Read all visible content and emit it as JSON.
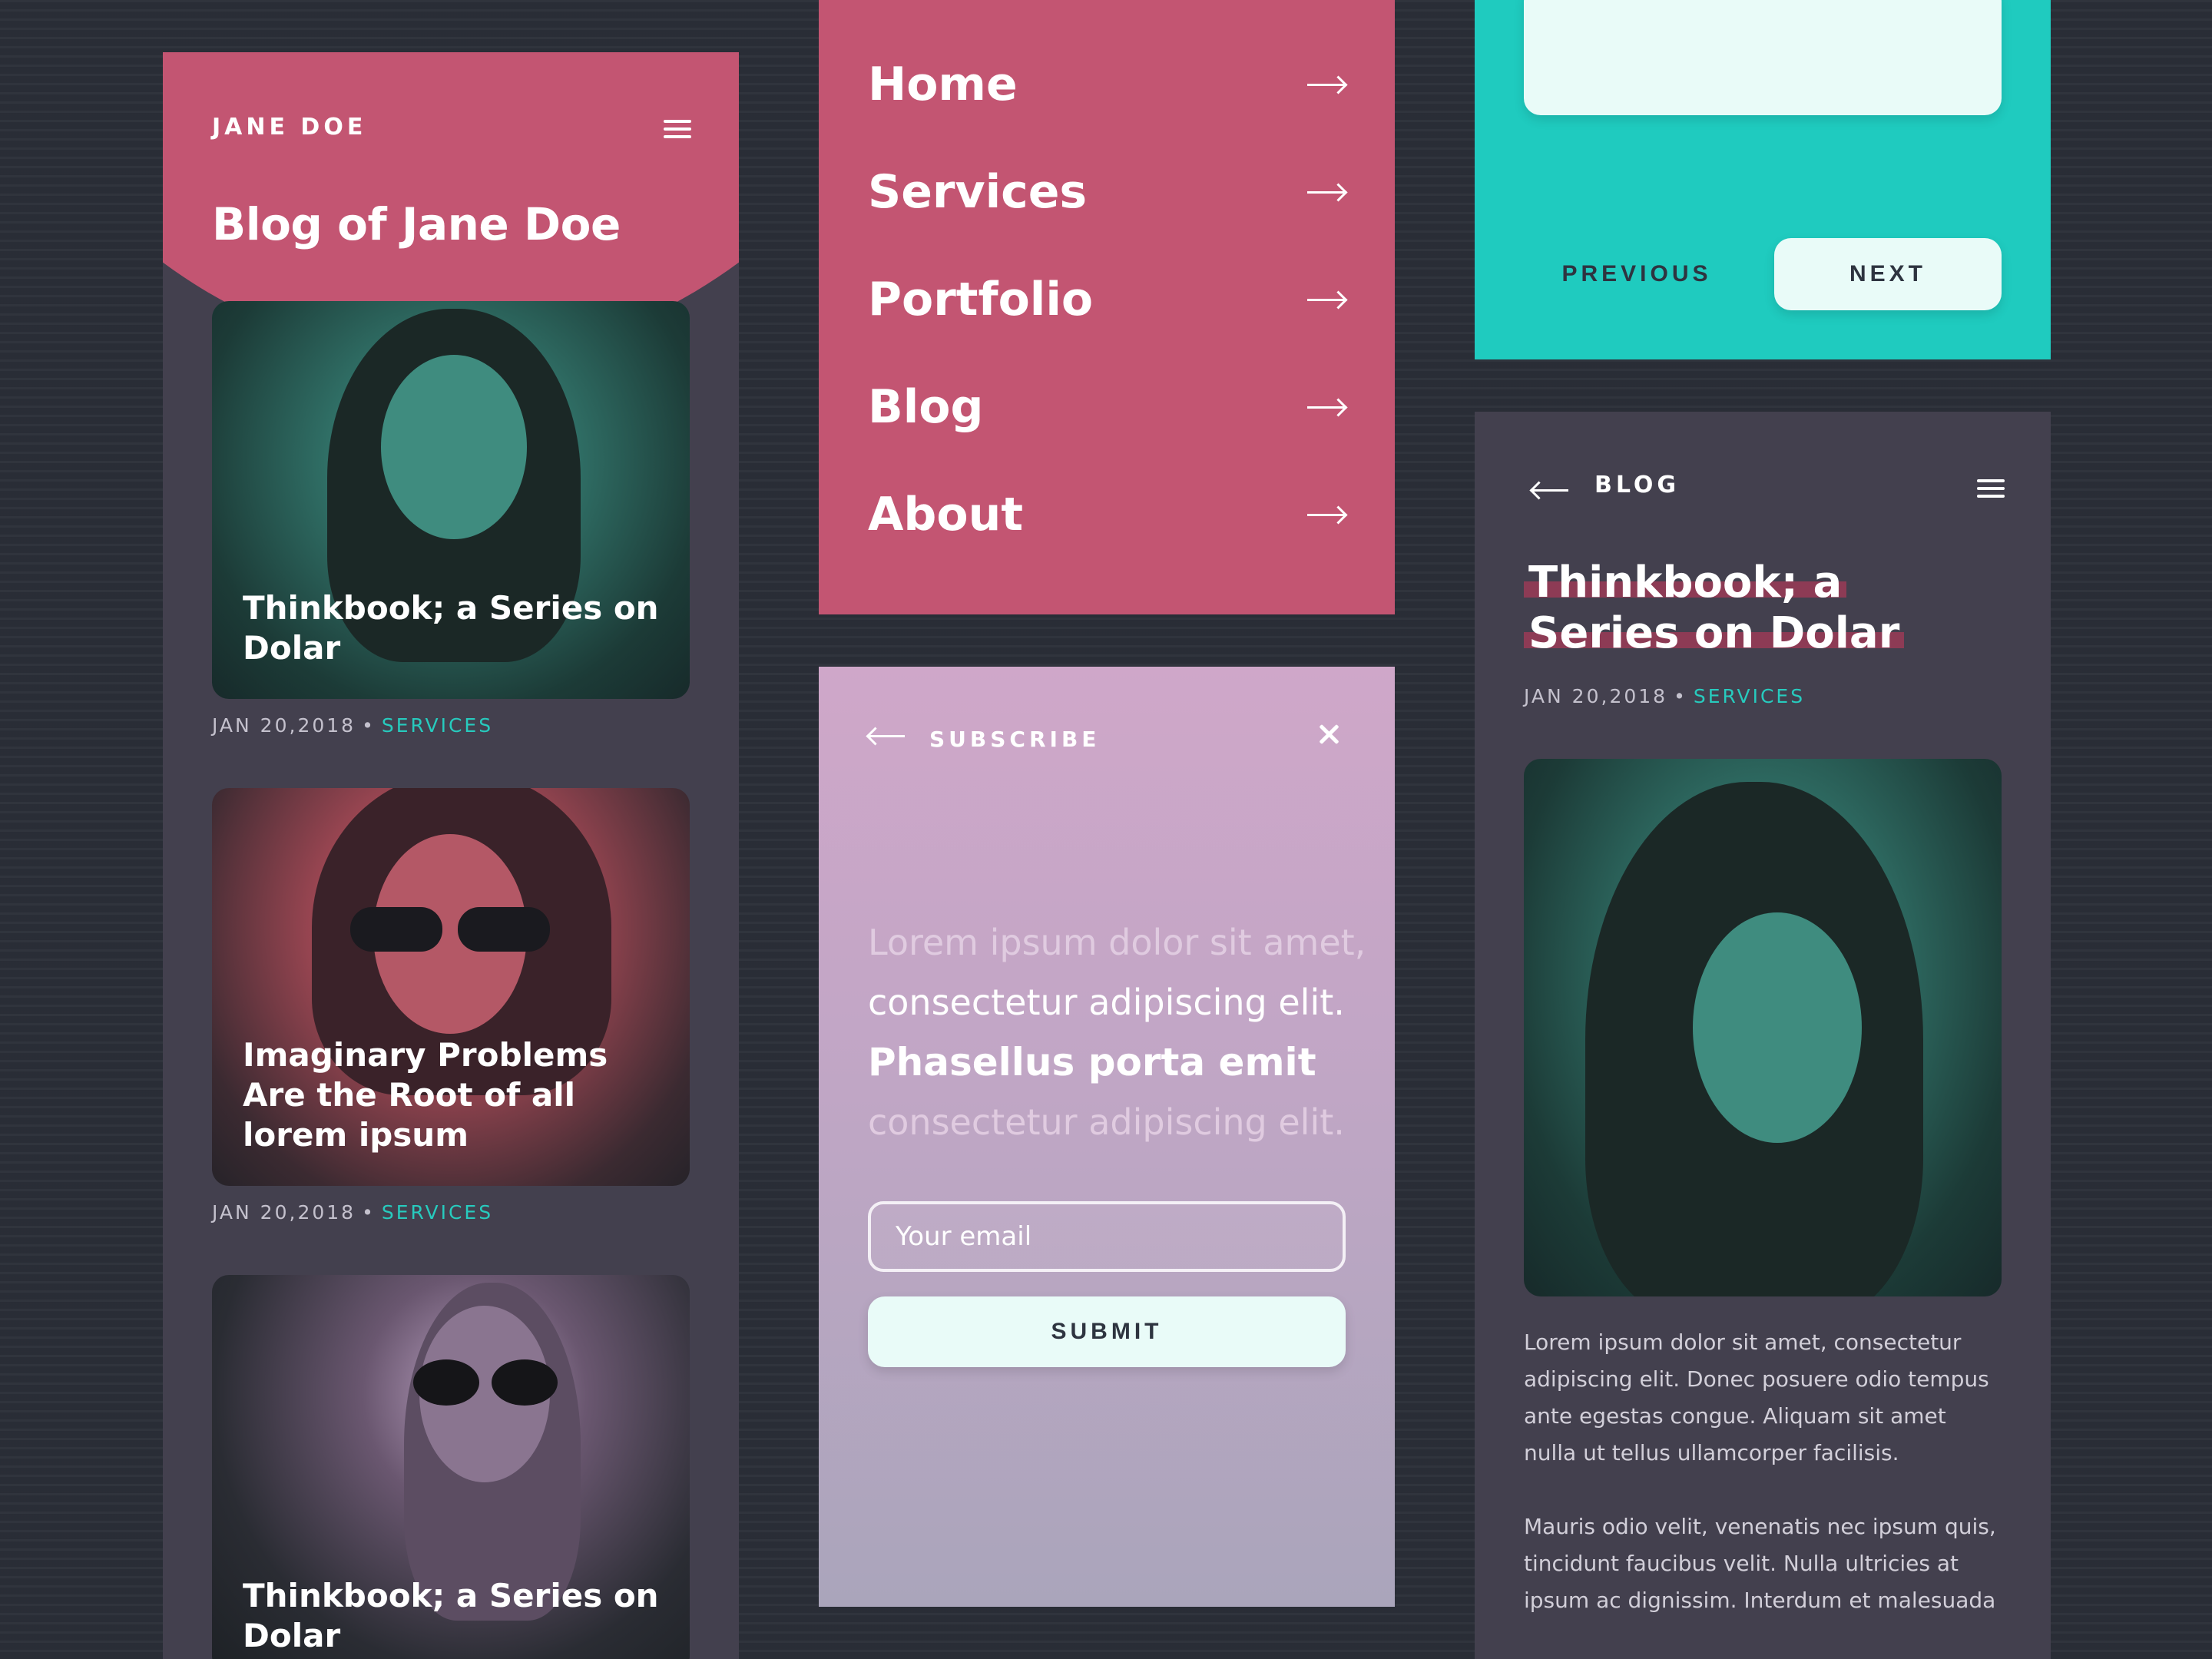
{
  "blog_list": {
    "brand": "JANE DOE",
    "title": "Blog of Jane Doe",
    "posts": [
      {
        "title": "Thinkbook; a Series on Dolar",
        "date": "JAN 20,2018",
        "category": "SERVICES"
      },
      {
        "title": "Imaginary Problems Are the Root of all lorem ipsum",
        "date": "JAN 20,2018",
        "category": "SERVICES"
      },
      {
        "title": "Thinkbook; a Series on Dolar"
      }
    ]
  },
  "nav_menu": {
    "items": [
      {
        "label": "Home"
      },
      {
        "label": "Services"
      },
      {
        "label": "Portfolio"
      },
      {
        "label": "Blog"
      },
      {
        "label": "About"
      }
    ]
  },
  "subscribe": {
    "header": "SUBSCRIBE",
    "lines": [
      "Lorem ipsum dolor sit amet,",
      "consectetur adipiscing elit.",
      "Phasellus porta emit",
      "consectetur adipiscing elit."
    ],
    "email_placeholder": "Your email",
    "submit_label": "SUBMIT"
  },
  "pager": {
    "previous_label": "PREVIOUS",
    "next_label": "NEXT"
  },
  "article": {
    "nav_label": "BLOG",
    "title_line1": "Thinkbook; a",
    "title_line2": "Series on Dolar",
    "date": "JAN 20,2018",
    "category": "SERVICES",
    "paragraph1": "Lorem ipsum dolor sit amet, consectetur adipiscing elit. Donec posuere odio tempus ante egestas congue. Aliquam sit amet nulla ut tellus ullamcorper facilisis.",
    "paragraph2": "Mauris odio velit, venenatis nec ipsum quis, tincidunt faucibus velit. Nulla ultricies at ipsum ac dignissim. Interdum et malesuada"
  },
  "colors": {
    "background": "#2b2f38",
    "pink": "#c35572",
    "teal": "#1fcbbf",
    "card_dark": "#43404e",
    "mint": "#e9fbf8",
    "lavender": "#c0a6c5"
  },
  "icons": [
    "menu-icon",
    "arrow-right-icon",
    "arrow-left-icon",
    "close-icon"
  ]
}
